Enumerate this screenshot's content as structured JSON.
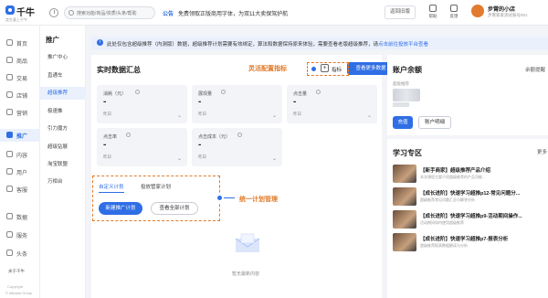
{
  "brand": {
    "logo_text": "千牛",
    "tagline": "卖生意上千牛"
  },
  "search": {
    "placeholder": "搜索功能/商品/资质/头条/帮助"
  },
  "notice": {
    "label": "公告",
    "text": "免费领取正版商用字体，为双11大卖保驾护航"
  },
  "header": {
    "old_version": "返回旧版",
    "help_label": "帮助",
    "feedback_label": "反馈",
    "shop_name": "步霄的小店",
    "shop_sub": "步霄家家测试账号001"
  },
  "sidebar": {
    "items": [
      {
        "label": "首页",
        "icon": "home-icon"
      },
      {
        "label": "商品",
        "icon": "goods-icon"
      },
      {
        "label": "交易",
        "icon": "trade-icon"
      },
      {
        "label": "店铺",
        "icon": "shop-icon"
      },
      {
        "label": "营销",
        "icon": "marketing-icon"
      },
      {
        "label": "推广",
        "icon": "promote-icon"
      },
      {
        "label": "内容",
        "icon": "content-icon"
      },
      {
        "label": "用户",
        "icon": "user-icon"
      },
      {
        "label": "客服",
        "icon": "service-icon"
      },
      {
        "label": "数据",
        "icon": "data-icon"
      },
      {
        "label": "服务",
        "icon": "services-icon"
      },
      {
        "label": "头条",
        "icon": "news-icon"
      }
    ],
    "about": "关于千牛",
    "copyright": "Copyright",
    "company": "© Alibaba Group"
  },
  "subnav": {
    "title": "推广",
    "items": [
      "推广中心",
      "直通车",
      "超级推荐",
      "极速推",
      "引力魔方",
      "超级钻展",
      "淘宝联盟",
      "万相台"
    ]
  },
  "info_bar": {
    "text": "此处仅包含超级推荐（内测版）数据，超级推荐计划需要有效绑定，算法和数据保持原来体验，需要查看老版超级推荐，请",
    "link": "点击前往投放平台查看"
  },
  "realtime": {
    "title": "实时数据汇总",
    "metric_label": "指标",
    "more_button": "查看更多数据",
    "metrics": [
      {
        "label": "消耗（元）",
        "value": "-",
        "sub": "昨日"
      },
      {
        "label": "展现量",
        "value": "-",
        "sub": "昨日"
      },
      {
        "label": "点击量",
        "value": "-",
        "sub": "昨日"
      },
      {
        "label": "点击率",
        "value": "-",
        "sub": "昨日"
      },
      {
        "label": "点击成本（元）",
        "value": "-",
        "sub": "昨日"
      }
    ]
  },
  "plans": {
    "tab_custom": "自定义计划",
    "tab_managed": "投放管家计划",
    "new_button": "新建推广计划",
    "all_button": "查看全部计划",
    "empty_text": "暂无最新内容"
  },
  "annotations": {
    "metric_config": "灵活配置指标",
    "plan_manage": "统一计划管理"
  },
  "balance": {
    "title": "账户余额",
    "right_label": "余额提醒",
    "sub_label": "超级推荐",
    "recharge": "充值",
    "detail": "账户明细"
  },
  "learning": {
    "title": "学习专区",
    "more": "更多",
    "items": [
      {
        "title": "【新手商家】超级推荐产品介绍",
        "desc": "本次课程主要介绍超级推荐的产品功能..."
      },
      {
        "title": "【成长进阶】快速学习超推p12-常见问题分...",
        "desc": "超级推荐常见问题汇总与解答分析"
      },
      {
        "title": "【成长进阶】快速学习超推p9-活动期间操作...",
        "desc": "活动期间如何使用超级推荐"
      },
      {
        "title": "【成长进阶】快速学习超推p7-报表分析",
        "desc": "超级推荐报表数据解读与分析"
      }
    ]
  },
  "colors": {
    "accent": "#2f6ee5",
    "annotation": "#e07b2a"
  }
}
